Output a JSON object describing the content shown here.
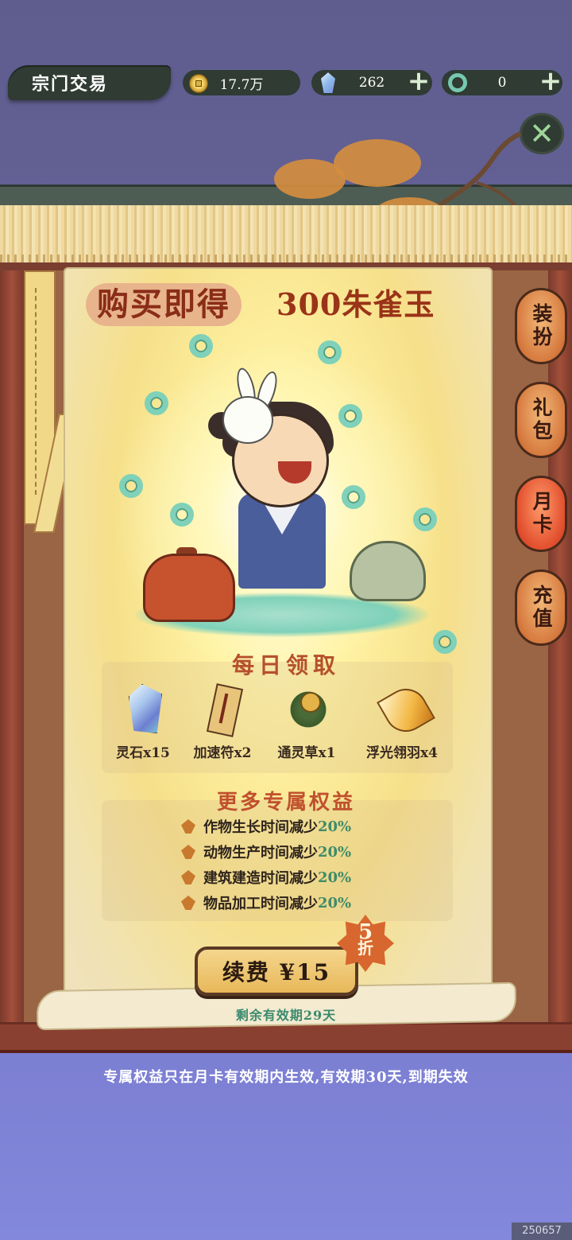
{
  "header": {
    "title": "宗门交易",
    "currencies": [
      {
        "icon": "copper-coin-icon",
        "value": "17.7万"
      },
      {
        "icon": "spirit-crystal-icon",
        "value": "262",
        "add": "+"
      },
      {
        "icon": "jade-ring-icon",
        "value": "0",
        "add": "+"
      }
    ],
    "close_icon": "close-icon",
    "close_glyph": "✕"
  },
  "banner": {
    "tag": "购买即得",
    "reward": "300朱雀玉"
  },
  "daily": {
    "title": "每日领取",
    "items": [
      {
        "icon": "spirit-stone-icon",
        "label": "灵石x15"
      },
      {
        "icon": "speed-talisman-icon",
        "label": "加速符x2"
      },
      {
        "icon": "spirit-herb-icon",
        "label": "通灵草x1"
      },
      {
        "icon": "floating-feather-icon",
        "label": "浮光翎羽x4"
      }
    ]
  },
  "benefits": {
    "title": "更多专属权益",
    "items": [
      {
        "text": "作物生长时间减少",
        "value": "20%"
      },
      {
        "text": "动物生产时间减少",
        "value": "20%"
      },
      {
        "text": "建筑建造时间减少",
        "value": "20%"
      },
      {
        "text": "物品加工时间减少",
        "value": "20%"
      }
    ]
  },
  "purchase": {
    "button": "续费 ¥15",
    "discount_number": "5",
    "discount_unit": "折",
    "validity": "剩余有效期29天"
  },
  "side_tabs": [
    {
      "label": "装扮",
      "active": false
    },
    {
      "label": "礼包",
      "active": false
    },
    {
      "label": "月卡",
      "active": true
    },
    {
      "label": "充值",
      "active": false
    }
  ],
  "notice": "专属权益只在月卡有效期内生效,有效期30天,到期失效",
  "watermark": "250657",
  "colors": {
    "accent": "#c0502e",
    "percent": "#3e8b6a",
    "background": "#6b6aa3"
  }
}
